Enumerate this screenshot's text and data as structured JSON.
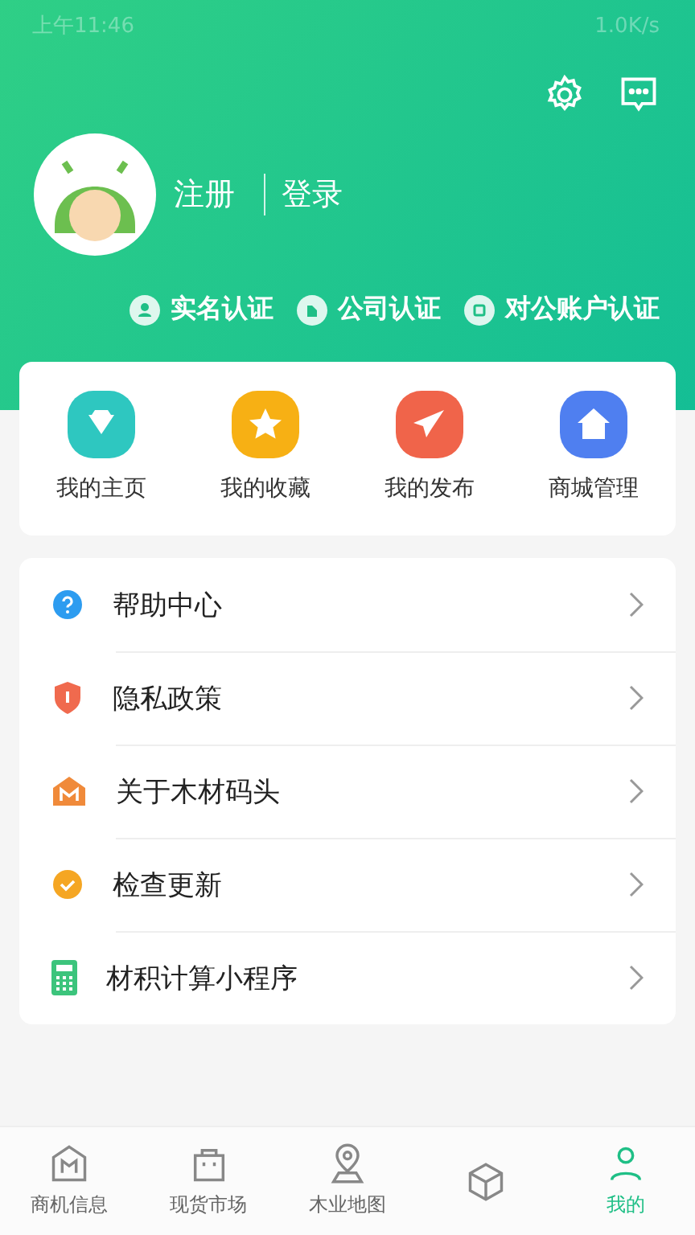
{
  "status_bar": {
    "time": "上午11:46",
    "speed": "1.0K/s"
  },
  "profile": {
    "register": "注册",
    "login": "登录"
  },
  "certifications": [
    {
      "label": "实名认证",
      "kind": "person"
    },
    {
      "label": "公司认证",
      "kind": "company"
    },
    {
      "label": "对公账户认证",
      "kind": "account"
    }
  ],
  "shortcuts": [
    {
      "label": "我的主页",
      "kind": "diamond",
      "color": "#2ec7c0"
    },
    {
      "label": "我的收藏",
      "kind": "star",
      "color": "#f7b014"
    },
    {
      "label": "我的发布",
      "kind": "plane",
      "color": "#f0644a"
    },
    {
      "label": "商城管理",
      "kind": "home",
      "color": "#4f7ff0"
    }
  ],
  "menu": [
    {
      "label": "帮助中心",
      "kind": "help"
    },
    {
      "label": "隐私政策",
      "kind": "shield"
    },
    {
      "label": "关于木材码头",
      "kind": "logo"
    },
    {
      "label": "检查更新",
      "kind": "check"
    },
    {
      "label": "材积计算小程序",
      "kind": "calc"
    }
  ],
  "bottom_nav": [
    {
      "label": "商机信息",
      "kind": "logo",
      "selected": false
    },
    {
      "label": "现货市场",
      "kind": "bag",
      "selected": false
    },
    {
      "label": "木业地图",
      "kind": "pin",
      "selected": false
    },
    {
      "kind": "cube",
      "selected": false
    },
    {
      "label": "我的",
      "kind": "person",
      "selected": true
    }
  ]
}
